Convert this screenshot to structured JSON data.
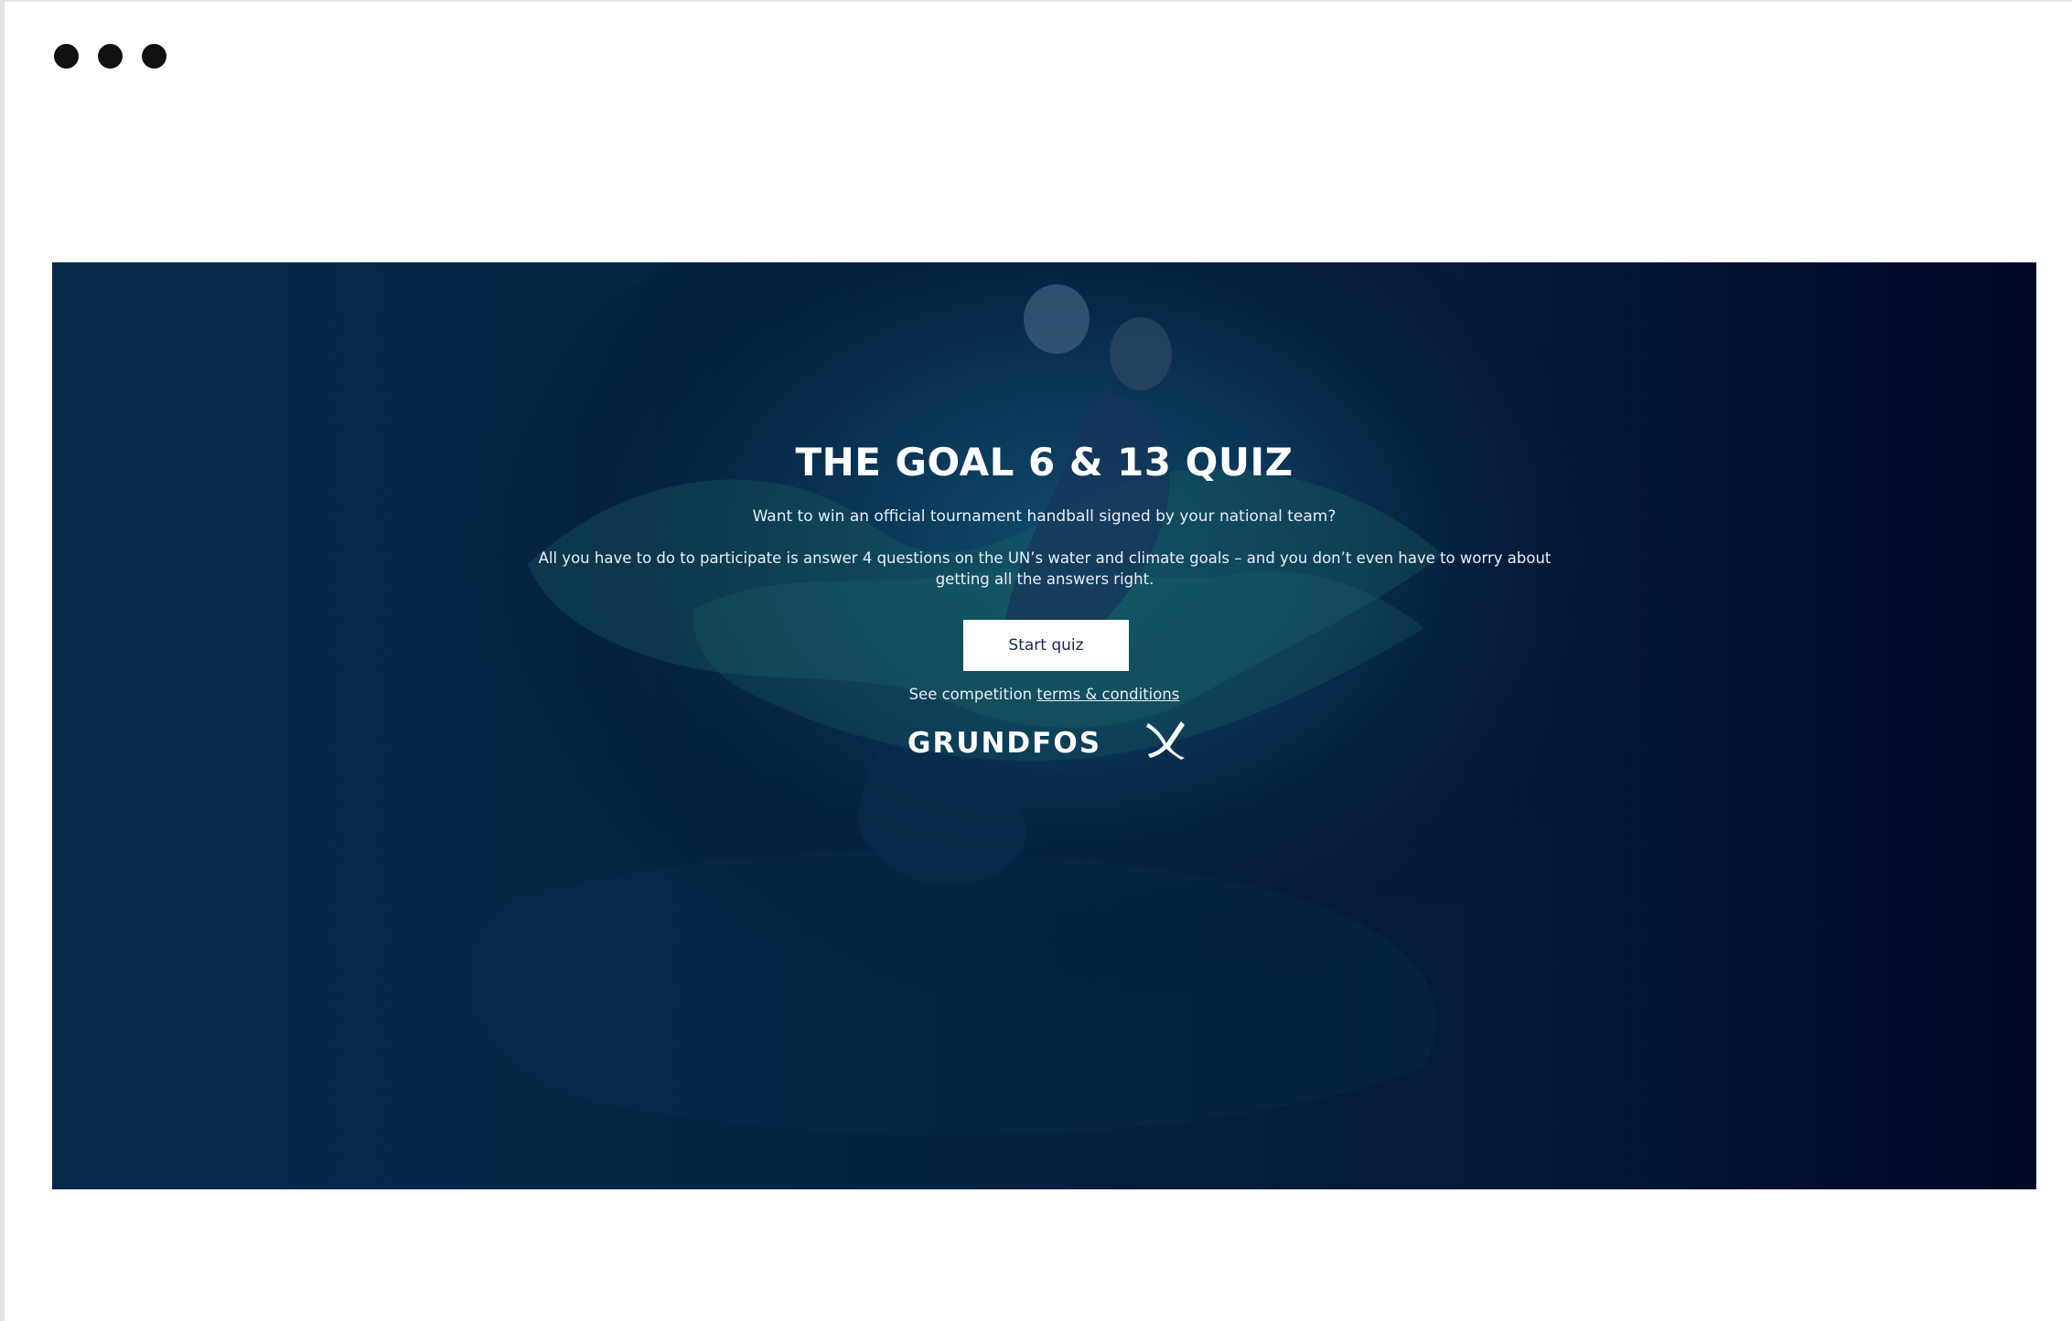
{
  "window": {
    "controls": [
      "dot",
      "dot",
      "dot"
    ]
  },
  "hero": {
    "title": "THE GOAL 6 & 13 QUIZ",
    "subtitle": "Want to win an official tournament handball signed by your national team?",
    "description": "All you have to do to participate is answer 4 questions on the UN’s water and climate goals – and you don’t even have to worry about getting all the answers right.",
    "start_button_label": "Start quiz",
    "terms_prefix": "See competition",
    "terms_link_label": "terms & conditions",
    "logo_text": "GRUNDFOS",
    "logo_mark_icon": "grundfos-x-icon",
    "background_image": "handball-player-water-splash",
    "colors": {
      "hero_background": "#030b26",
      "button_background": "#ffffff",
      "button_text": "#0b2a55",
      "text": "#ffffff"
    }
  }
}
